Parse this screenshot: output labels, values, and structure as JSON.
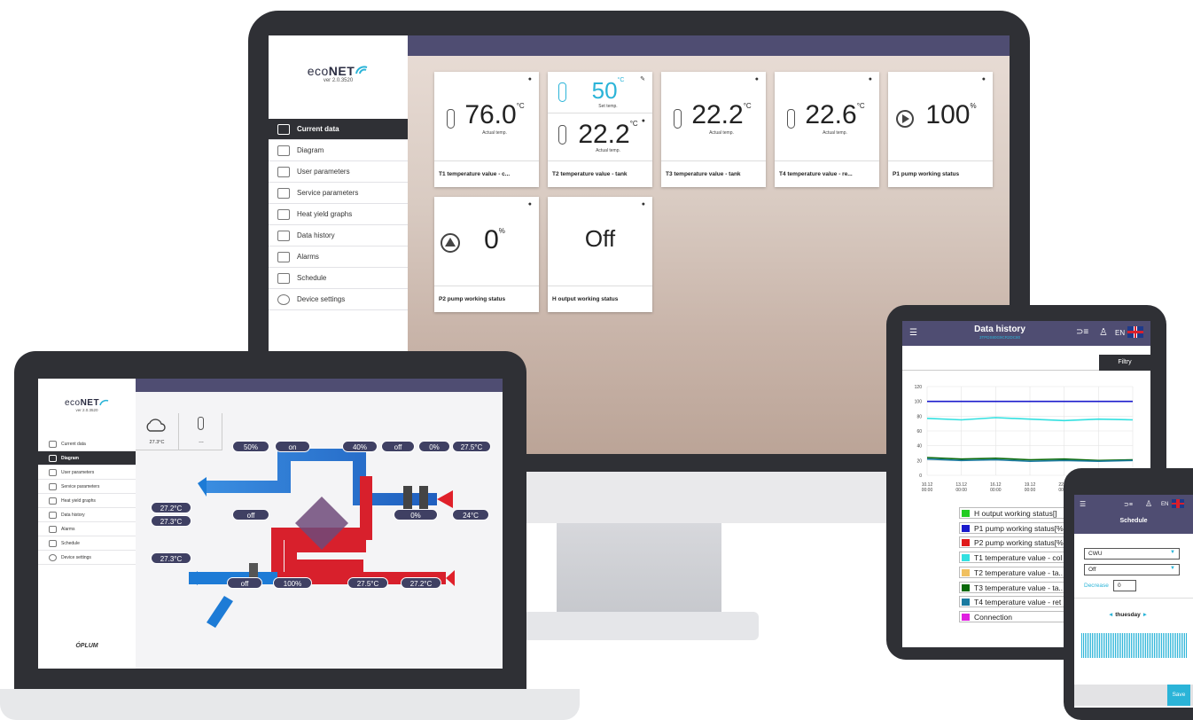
{
  "brand": {
    "logo_prefix": "eco",
    "logo_bold": "NET",
    "version": "ver 2.0.3520",
    "maker": "PLUM"
  },
  "colors": {
    "nav": "#4f4d72",
    "frame": "#2f3035",
    "accent": "#2bb4d8",
    "hot": "#e0202a",
    "cold": "#1d7bd6"
  },
  "desktop": {
    "nav": [
      {
        "label": "Current data",
        "icon": "current-data-icon"
      },
      {
        "label": "Diagram",
        "icon": "diagram-icon"
      },
      {
        "label": "User parameters",
        "icon": "user-parameters-icon"
      },
      {
        "label": "Service parameters",
        "icon": "service-parameters-icon"
      },
      {
        "label": "Heat yield graphs",
        "icon": "heat-yield-icon"
      },
      {
        "label": "Data history",
        "icon": "data-history-icon"
      },
      {
        "label": "Alarms",
        "icon": "alarm-icon"
      },
      {
        "label": "Schedule",
        "icon": "schedule-icon"
      },
      {
        "label": "Device settings",
        "icon": "gear-icon"
      }
    ],
    "tiles": [
      {
        "value": "76.0",
        "unit": "°C",
        "sub": "Actual temp.",
        "name": "T1 temperature value - c..."
      },
      {
        "value": "50",
        "unit": "°C",
        "sub": "Set temp.",
        "value2": "22.2",
        "unit2": "°C",
        "sub2": "Actual temp.",
        "name": "T2 temperature value - tank"
      },
      {
        "value": "22.2",
        "unit": "°C",
        "sub": "Actual temp.",
        "name": "T3 temperature value - tank"
      },
      {
        "value": "22.6",
        "unit": "°C",
        "sub": "Actual temp.",
        "name": "T4 temperature value - re..."
      },
      {
        "value": "100",
        "unit": "%",
        "sub": "",
        "name": "P1 pump working status"
      },
      {
        "value": "0",
        "unit": "%",
        "sub": "",
        "name": "P2 pump working status"
      },
      {
        "value": "Off",
        "unit": "",
        "sub": "",
        "name": "H output working status"
      }
    ]
  },
  "laptop": {
    "weather": {
      "temp": "27.3°C",
      "second": "---"
    },
    "diagram": {
      "fan_exhaust": "50%",
      "fan_exhaust_state": "on",
      "heater_pct": "40%",
      "heater_state": "off",
      "cooler_pct": "0%",
      "supply_out_temp": "27.5°C",
      "exhaust_out_temp": "27.2°C",
      "exhaust_in_temp": "27.3°C",
      "bypass_state": "off",
      "bypass_pct": "0%",
      "room_temp": "24°C",
      "outside_temp": "27.3°C",
      "preheater_state": "off",
      "fan_supply": "100%",
      "supply_temp": "27.5°C",
      "extract_temp": "27.2°C"
    }
  },
  "tablet": {
    "title": "Data history",
    "subtitle": "3TPDS80G9CR2DC80",
    "lang": "EN",
    "filter_label": "Filtry",
    "legend": [
      {
        "label": "H output working status[]",
        "color": "#22cc22"
      },
      {
        "label": "P1 pump working status[%",
        "color": "#1a1acc"
      },
      {
        "label": "P2 pump working status[%",
        "color": "#e01a1a"
      },
      {
        "label": "T1 temperature value - col",
        "color": "#33e0e0"
      },
      {
        "label": "T2 temperature value - ta..",
        "color": "#f0c060"
      },
      {
        "label": "T3 temperature value - ta..",
        "color": "#0a6a0a"
      },
      {
        "label": "T4 temperature value - ret",
        "color": "#1a7aa0"
      },
      {
        "label": "Connection",
        "color": "#e020e0"
      }
    ]
  },
  "chart_data": {
    "type": "line",
    "x": [
      "10.12 00:00",
      "13.12 00:00",
      "16.12 00:00",
      "19.12 00:00",
      "22.12 00:00",
      "25.12 00:00",
      "28.12 00:00"
    ],
    "ylim": [
      0,
      120
    ],
    "yticks": [
      0,
      20,
      40,
      60,
      80,
      100,
      120
    ],
    "series": [
      {
        "name": "P1 pump working status[%",
        "color": "#1a1acc",
        "values": [
          100,
          100,
          100,
          100,
          100,
          100,
          100
        ]
      },
      {
        "name": "T1 temperature value - col",
        "color": "#33e0e0",
        "values": [
          77,
          75,
          78,
          76,
          74,
          76,
          75
        ]
      },
      {
        "name": "T3 temperature value - ta..",
        "color": "#0a6a0a",
        "values": [
          24,
          22,
          23,
          21,
          22,
          20,
          21
        ]
      },
      {
        "name": "T4 temperature value - ret",
        "color": "#1a7aa0",
        "values": [
          22,
          20,
          21,
          19,
          20,
          19,
          20
        ]
      }
    ]
  },
  "phone": {
    "title": "Schedule",
    "lang": "EN",
    "circuit": "CWU",
    "mode": "Off",
    "decrease_label": "Decrease",
    "decrease_value": "0",
    "day": "thuesday",
    "save_label": "Save"
  }
}
